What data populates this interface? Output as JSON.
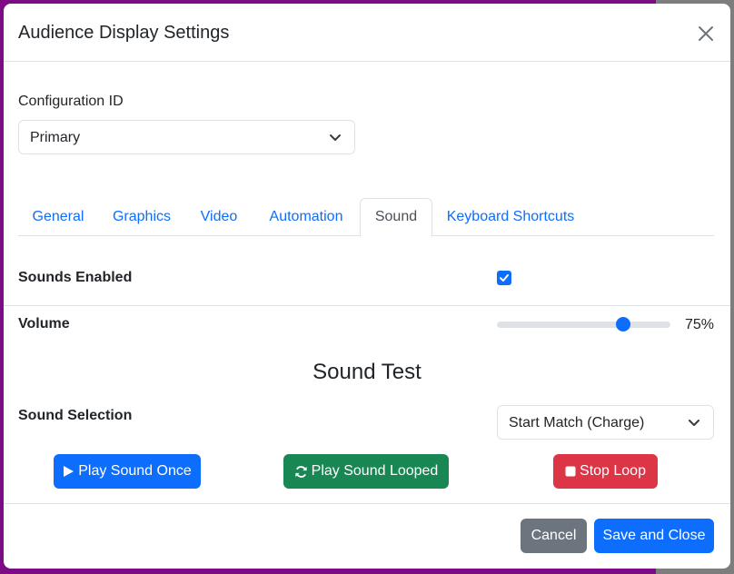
{
  "modal": {
    "title": "Audience Display Settings"
  },
  "configuration": {
    "label": "Configuration ID",
    "selected": "Primary"
  },
  "tabs": [
    {
      "label": "General",
      "active": false
    },
    {
      "label": "Graphics",
      "active": false
    },
    {
      "label": "Video",
      "active": false
    },
    {
      "label": "Automation",
      "active": false
    },
    {
      "label": "Sound",
      "active": true
    },
    {
      "label": "Keyboard Shortcuts",
      "active": false
    }
  ],
  "sound": {
    "enabled_label": "Sounds Enabled",
    "enabled": true,
    "volume_label": "Volume",
    "volume_value": 0.75,
    "volume_text": "75%",
    "test_title": "Sound Test",
    "selection_label": "Sound Selection",
    "selection_value": "Start Match (Charge)",
    "play_once_label": "Play Sound Once",
    "play_looped_label": "Play Sound Looped",
    "stop_loop_label": "Stop Loop"
  },
  "footer": {
    "cancel_label": "Cancel",
    "save_label": "Save and Close"
  },
  "colors": {
    "primary": "#0d6efd",
    "success": "#198754",
    "danger": "#dc3545",
    "secondary": "#6c757d",
    "backdrop": "#7d0b86"
  }
}
